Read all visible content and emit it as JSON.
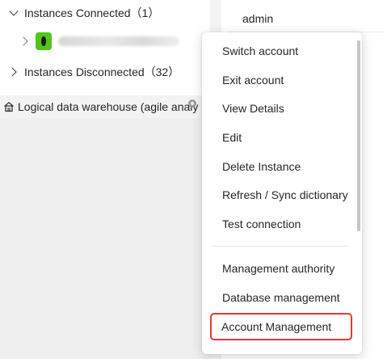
{
  "tree": {
    "connected_label": "Instances Connected（1）",
    "instance_name_hint": "W",
    "disconnected_label": "Instances Disconnected（32）",
    "warehouse_label": "Logical data warehouse (agile analy"
  },
  "header": {
    "user": "admin"
  },
  "context_menu": {
    "items": [
      {
        "label": "Switch account"
      },
      {
        "label": "Exit account"
      },
      {
        "label": "View Details"
      },
      {
        "label": "Edit"
      },
      {
        "label": "Delete Instance"
      },
      {
        "label": "Refresh / Sync dictionary"
      },
      {
        "label": "Test connection"
      },
      {
        "label": "Management authority"
      },
      {
        "label": "Database management"
      },
      {
        "label": "Account Management",
        "highlighted": true
      }
    ]
  },
  "colors": {
    "badge": "#52c41a",
    "highlight_border": "#e53935"
  }
}
